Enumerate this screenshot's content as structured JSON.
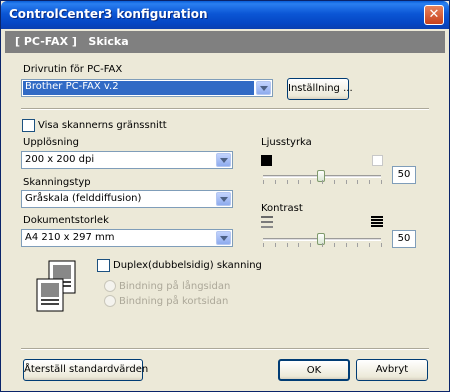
{
  "window": {
    "title": "ControlCenter3 konfiguration",
    "close": "✕"
  },
  "header": {
    "text": "[ PC-FAX ]   Skicka"
  },
  "driver": {
    "label": "Drivrutin för PC-FAX",
    "value": "Brother PC-FAX v.2",
    "settings_button": "Inställning ..."
  },
  "scanner_interface": {
    "label": "Visa skannerns gränssnitt",
    "checked": false
  },
  "resolution": {
    "label": "Upplösning",
    "value": "200 x 200 dpi"
  },
  "scan_type": {
    "label": "Skanningstyp",
    "value": "Gråskala (felddiffusion)"
  },
  "document_size": {
    "label": "Dokumentstorlek",
    "value": "A4 210 x 297 mm"
  },
  "brightness": {
    "label": "Ljusstyrka",
    "value": "50"
  },
  "contrast": {
    "label": "Kontrast",
    "value": "50"
  },
  "duplex": {
    "label": "Duplex(dubbelsidig) skanning",
    "checked": false,
    "option_long": "Bindning på långsidan",
    "option_short": "Bindning på kortsidan"
  },
  "footer": {
    "restore": "Återställ standardvärden",
    "ok": "OK",
    "cancel": "Avbryt"
  },
  "colors": {
    "title_bar": "#0b56d5",
    "header_band": "#808080",
    "selection": "#316ac5"
  }
}
